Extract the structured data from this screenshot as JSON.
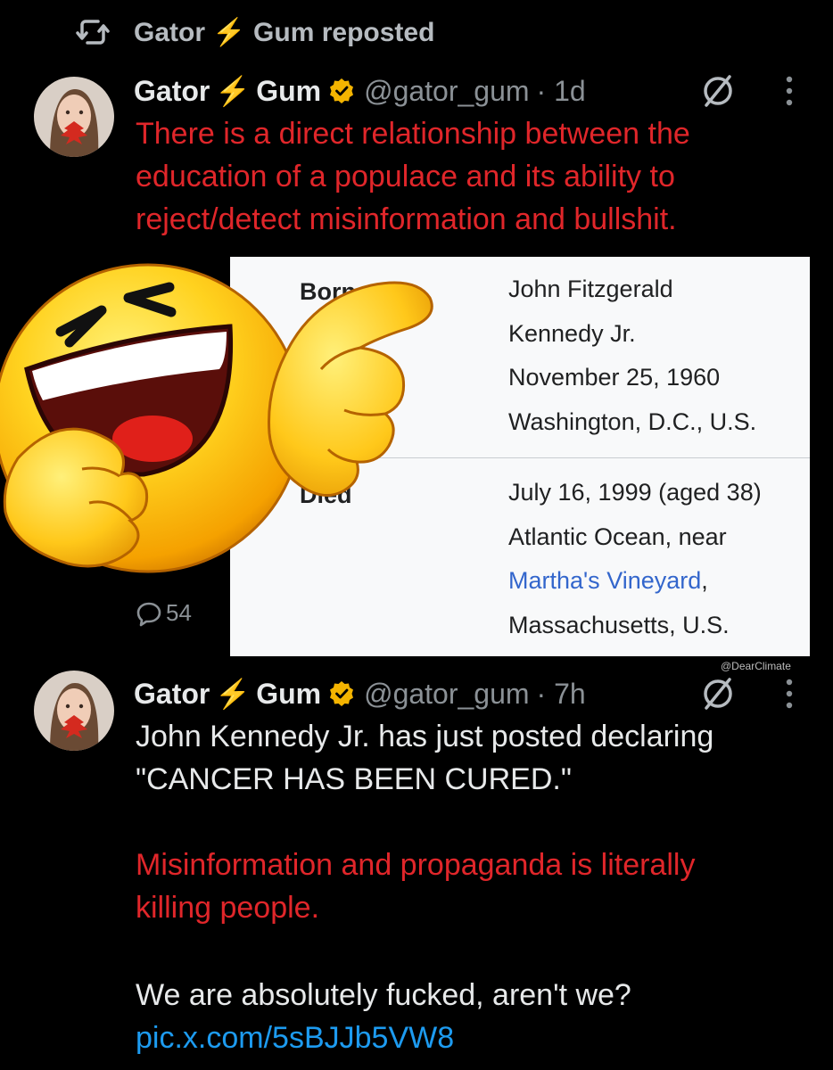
{
  "repost": {
    "label": "Gator ⚡ Gum reposted"
  },
  "tweet1": {
    "display_name_a": "Gator",
    "bolt": "⚡",
    "display_name_b": "Gum",
    "handle": "@gator_gum",
    "time": "· 1d",
    "text": "There is a direct relationship between the education of a populace and its ability to reject/detect misinformation and bullshit.",
    "reply_count": "54"
  },
  "infobox": {
    "born_label": "Born",
    "born_lines": [
      "John Fitzgerald",
      "Kennedy Jr.",
      "November 25, 1960",
      "Washington, D.C., U.S."
    ],
    "died_label": "Died",
    "died_lines": [
      "July 16, 1999 (aged 38)",
      "Atlantic Ocean, near"
    ],
    "died_link": "Martha's Vineyard",
    "died_link_suffix": ",",
    "died_last": "Massachusetts, U.S."
  },
  "watermark": "@DearClimate",
  "tweet2": {
    "display_name_a": "Gator",
    "bolt": "⚡",
    "display_name_b": "Gum",
    "handle": "@gator_gum",
    "time": "· 7h",
    "text1_line1": "John Kennedy Jr. has just posted declaring",
    "text1_line2": "\"CANCER HAS BEEN CURED.\"",
    "text2": "Misinformation and propaganda is literally killing people.",
    "text3": "We are absolutely fucked, aren't we?",
    "link": "pic.x.com/5sBJJb5VW8"
  },
  "icons": {
    "repost": "repost-icon",
    "verified": "verified-badge-icon",
    "muted": "slash-circle-icon",
    "more": "more-vertical-icon",
    "reply": "reply-bubble-icon",
    "emoji": "laughing-pointing-emoji-icon"
  },
  "colors": {
    "background": "#000000",
    "red_text": "#e0262a",
    "link": "#1d9bf0",
    "verified": "#f4b400",
    "muted_text": "#8b9196"
  }
}
